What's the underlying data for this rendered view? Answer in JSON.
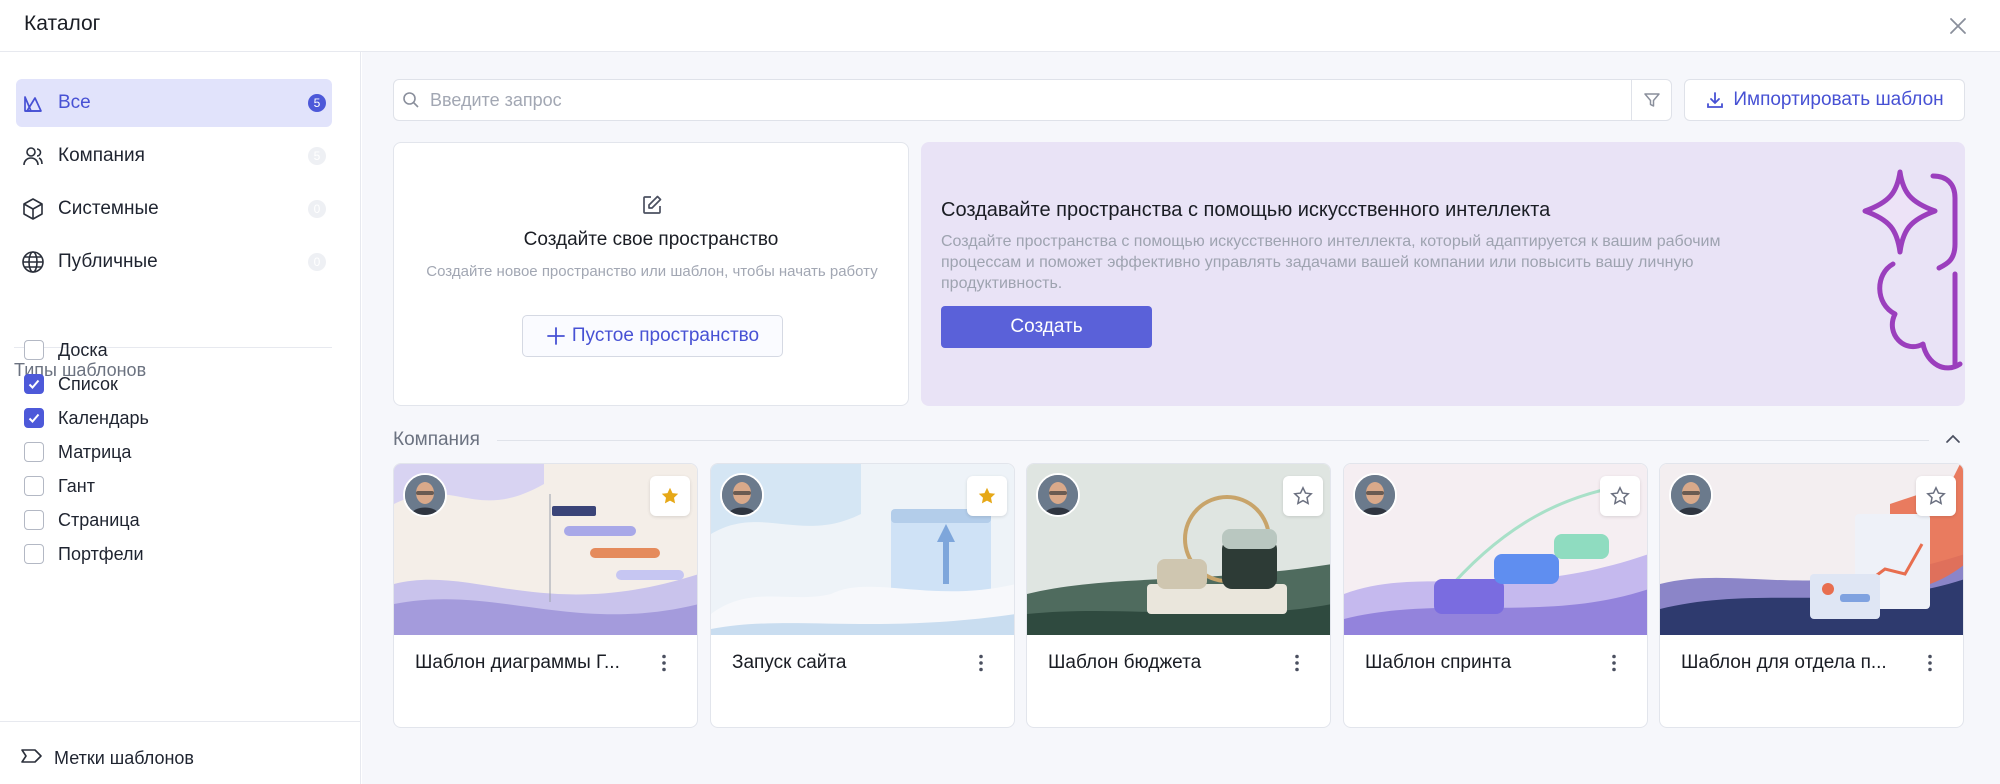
{
  "window": {
    "title": "Каталог"
  },
  "sidebar": {
    "nav": [
      {
        "label": "Все",
        "count": "5",
        "icon": "templates-icon",
        "active": true
      },
      {
        "label": "Компания",
        "count": "5",
        "icon": "users-icon"
      },
      {
        "label": "Системные",
        "count": "0",
        "icon": "cube-icon"
      },
      {
        "label": "Публичные",
        "count": "0",
        "icon": "globe-icon"
      }
    ],
    "types_title": "Типы шаблонов",
    "types": [
      {
        "label": "Доска",
        "checked": false
      },
      {
        "label": "Список",
        "checked": true
      },
      {
        "label": "Календарь",
        "checked": true
      },
      {
        "label": "Матрица",
        "checked": false
      },
      {
        "label": "Гант",
        "checked": false
      },
      {
        "label": "Страница",
        "checked": false
      },
      {
        "label": "Портфели",
        "checked": false
      }
    ],
    "footer_label": "Метки шаблонов"
  },
  "toolbar": {
    "search_placeholder": "Введите запрос",
    "import_label": "Импортировать шаблон"
  },
  "create_card": {
    "title": "Создайте свое пространство",
    "subtitle": "Создайте новое пространство или шаблон, чтобы начать работу",
    "button": "Пустое пространство"
  },
  "ai_card": {
    "title": "Создавайте пространства с помощью искусственного интеллекта",
    "subtitle": "Создайте пространства с помощью искусственного интеллекта, который адаптируется к вашим рабочим процессам и поможет эффективно управлять задачами вашей компании или повысить вашу личную продуктивность.",
    "button": "Создать"
  },
  "section": {
    "title": "Компания"
  },
  "templates": [
    {
      "title": "Шаблон диаграммы Г...",
      "starred": true
    },
    {
      "title": "Запуск сайта",
      "starred": true
    },
    {
      "title": "Шаблон бюджета",
      "starred": false
    },
    {
      "title": "Шаблон спринта",
      "starred": false
    },
    {
      "title": "Шаблон для отдела п...",
      "starred": false
    }
  ],
  "colors": {
    "accent": "#4d59d9",
    "star": "#e6a817",
    "ai_bg": "#e9e3f6",
    "ai_art": "#9b3fbd"
  }
}
